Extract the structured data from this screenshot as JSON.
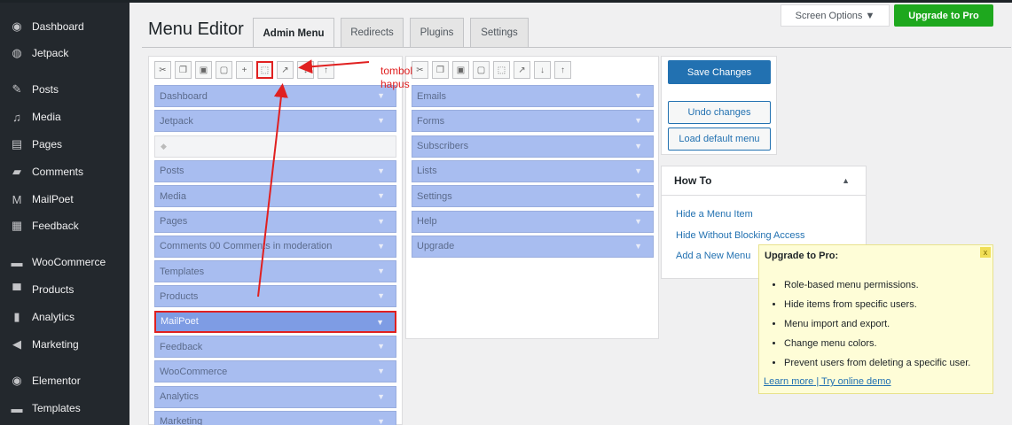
{
  "sidebar": {
    "items": [
      {
        "label": "Dashboard",
        "icon": "dashboard-icon",
        "glyph": "◉"
      },
      {
        "label": "Jetpack",
        "icon": "jetpack-icon",
        "glyph": "◍"
      },
      {
        "label": "Posts",
        "icon": "pin-icon",
        "glyph": "✎"
      },
      {
        "label": "Media",
        "icon": "media-icon",
        "glyph": "♫"
      },
      {
        "label": "Pages",
        "icon": "pages-icon",
        "glyph": "▤"
      },
      {
        "label": "Comments",
        "icon": "comment-icon",
        "glyph": "▰"
      },
      {
        "label": "MailPoet",
        "icon": "mailpoet-icon",
        "glyph": "M"
      },
      {
        "label": "Feedback",
        "icon": "feedback-icon",
        "glyph": "▦"
      },
      {
        "label": "WooCommerce",
        "icon": "woocommerce-icon",
        "glyph": "▬"
      },
      {
        "label": "Products",
        "icon": "products-icon",
        "glyph": "▀"
      },
      {
        "label": "Analytics",
        "icon": "analytics-icon",
        "glyph": "▮"
      },
      {
        "label": "Marketing",
        "icon": "megaphone-icon",
        "glyph": "◀"
      },
      {
        "label": "Elementor",
        "icon": "elementor-icon",
        "glyph": "◉"
      },
      {
        "label": "Templates",
        "icon": "folder-icon",
        "glyph": "▬"
      }
    ]
  },
  "header": {
    "title": "Menu Editor",
    "tabs": [
      "Admin Menu",
      "Redirects",
      "Plugins",
      "Settings"
    ],
    "screen_options": "Screen Options ▼",
    "upgrade": "Upgrade to Pro"
  },
  "left_menu": {
    "items": [
      {
        "label": "Dashboard"
      },
      {
        "label": "Jetpack"
      },
      {
        "label": "",
        "separator": true
      },
      {
        "label": "Posts"
      },
      {
        "label": "Media"
      },
      {
        "label": "Pages"
      },
      {
        "label": "Comments 00 Comments in moderation"
      },
      {
        "label": "Templates"
      },
      {
        "label": "Products"
      },
      {
        "label": "MailPoet",
        "selected": true
      },
      {
        "label": "Feedback"
      },
      {
        "label": "WooCommerce"
      },
      {
        "label": "Analytics"
      },
      {
        "label": "Marketing"
      }
    ]
  },
  "right_menu": {
    "items": [
      "Emails",
      "Forms",
      "Subscribers",
      "Lists",
      "Settings",
      "Help",
      "Upgrade"
    ]
  },
  "actions": {
    "save": "Save Changes",
    "undo": "Undo changes",
    "load_default": "Load default menu"
  },
  "howto": {
    "title": "How To",
    "links": [
      "Hide a Menu Item",
      "Hide Without Blocking Access",
      "Add a New Menu"
    ]
  },
  "tooltip": {
    "title": "Upgrade to Pro:",
    "close": "x",
    "items": [
      "Role-based menu permissions.",
      "Hide items from specific users.",
      "Menu import and export.",
      "Change menu colors.",
      "Prevent users from deleting a specific user."
    ],
    "learn_more": "Learn more",
    "separator": " | ",
    "try_demo": "Try online demo"
  },
  "annotation": {
    "line1": "tombol",
    "line2": "hapus",
    "color": "#e02020"
  }
}
